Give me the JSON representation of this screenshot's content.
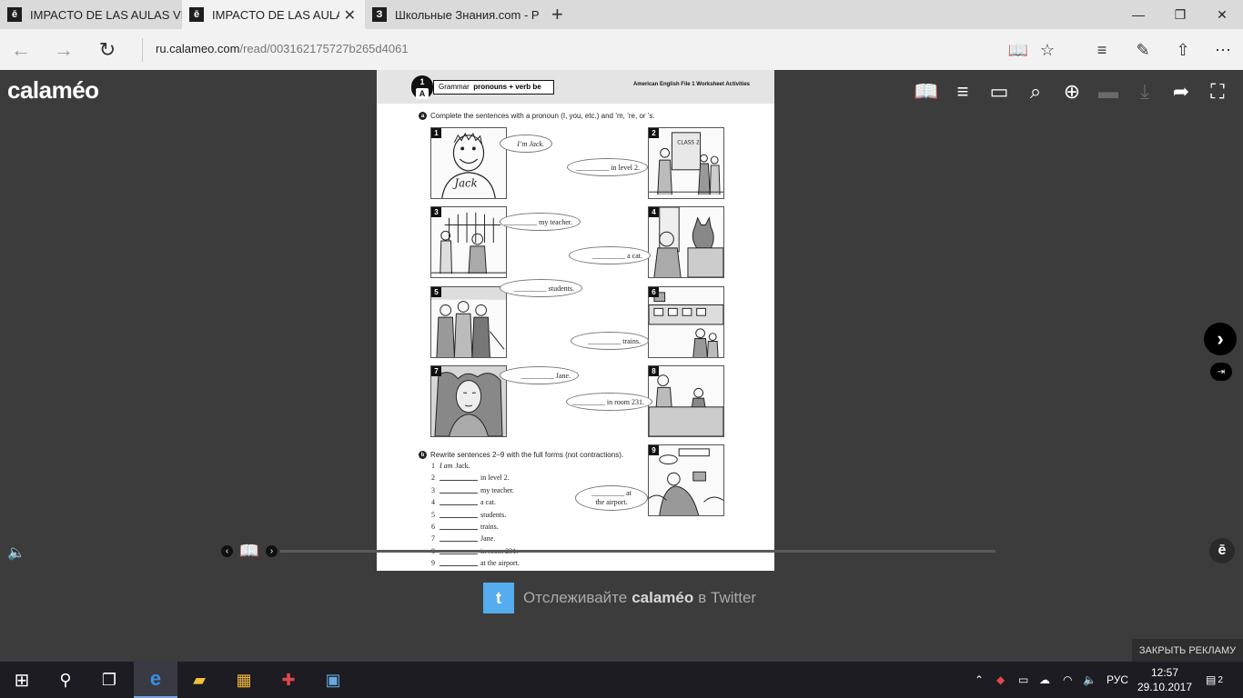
{
  "browser": {
    "tabs": [
      {
        "favicon": "ē",
        "title": "IMPACTO DE LAS AULAS VII",
        "active": false
      },
      {
        "favicon": "ē",
        "title": "IMPACTO DE LAS AULA",
        "active": true,
        "close": "✕"
      },
      {
        "favicon": "З",
        "title": "Школьные Знания.com - Р",
        "active": false
      }
    ],
    "new_tab": "+",
    "window_controls": {
      "minimize": "—",
      "restore": "❐",
      "close": "✕"
    },
    "nav": {
      "back": "←",
      "forward": "→",
      "refresh": "↻"
    },
    "url_domain": "ru.calameo.com",
    "url_path": "/read/003162175727b265d4061",
    "toolbar_icons": [
      "reading-view-icon",
      "favorites-star-icon",
      "hub-icon",
      "web-note-icon",
      "share-icon",
      "more-icon"
    ],
    "toolbar_glyphs": {
      "reading": "📖",
      "star": "☆",
      "hub": "≡",
      "note": "✎",
      "share": "⇧",
      "more": "⋯"
    }
  },
  "viewer": {
    "logo": "calaméo",
    "tool_glyphs": {
      "book": "📖",
      "list": "≡",
      "folder": "▭",
      "search": "⌕",
      "zoom": "⊕",
      "print": "▬",
      "download": "⤓",
      "share": "➦",
      "fullscreen": "⛶"
    },
    "next_page": "›",
    "last_page": "⇥",
    "prev_arrow": "‹",
    "next_arrow": "›",
    "book_glyph": "📖",
    "sound_glyph": "🔈",
    "badge": "ē",
    "twitter_text_before": "Отслеживайте",
    "twitter_brand": "calaméo",
    "twitter_text_after": "в Twitter",
    "twitter_glyph": "t",
    "close_ad": "ЗАКРЫТЬ РЕКЛАМУ"
  },
  "document": {
    "lesson_number": "1",
    "lesson_letter": "A",
    "grammar_label": "Grammar",
    "grammar_topic": "pronouns + verb be",
    "header_right": "American English File 1 Worksheet Activities",
    "exercise_a_letter": "a",
    "exercise_a_instruction": "Complete the sentences with a pronoun (I, you, etc.) and ’m, ’re, or ’s.",
    "pictures": [
      "1",
      "2",
      "3",
      "4",
      "5",
      "6",
      "7",
      "8",
      "9"
    ],
    "picture_texts": {
      "jack": "Jack",
      "class": "CLASS 2"
    },
    "bubbles": {
      "b1": "I’m Jack.",
      "b2": "_________ in level 2.",
      "b3": "_________ my teacher.",
      "b4": "_________ a cat.",
      "b5": "_________ students.",
      "b6": "_________ trains.",
      "b7": "_________ Jane.",
      "b8": "_________ in room 231.",
      "b9_line1": "_________ at",
      "b9_line2": "the airport."
    },
    "exercise_b_letter": "b",
    "exercise_b_instruction": "Rewrite sentences 2–9 with the full forms (not contractions).",
    "answers": [
      {
        "n": "1",
        "prefix": "I am",
        "text": "Jack."
      },
      {
        "n": "2",
        "text": "in level 2."
      },
      {
        "n": "3",
        "text": "my teacher."
      },
      {
        "n": "4",
        "text": "a cat."
      },
      {
        "n": "5",
        "text": "students."
      },
      {
        "n": "6",
        "text": "trains."
      },
      {
        "n": "7",
        "text": "Jane."
      },
      {
        "n": "8",
        "text": "in room 231."
      },
      {
        "n": "9",
        "text": "at the airport."
      }
    ]
  },
  "taskbar": {
    "start": "⊞",
    "search": "⚲",
    "task_view": "❐",
    "apps": [
      "edge-icon",
      "file-explorer-icon",
      "store-icon",
      "gift-app-icon",
      "screen-app-icon"
    ],
    "app_glyphs": {
      "edge": "e",
      "explorer": "▰",
      "store": "▦",
      "gift": "✚",
      "screen": "▣"
    },
    "tray_glyphs": {
      "chevron": "⌃",
      "shield": "◆",
      "battery": "▭",
      "cloud": "☁",
      "wifi": "◠",
      "volume": "🔈",
      "notifications": "▤"
    },
    "language": "РУС",
    "time": "12:57",
    "date": "29.10.2017",
    "notification_count": "2"
  }
}
